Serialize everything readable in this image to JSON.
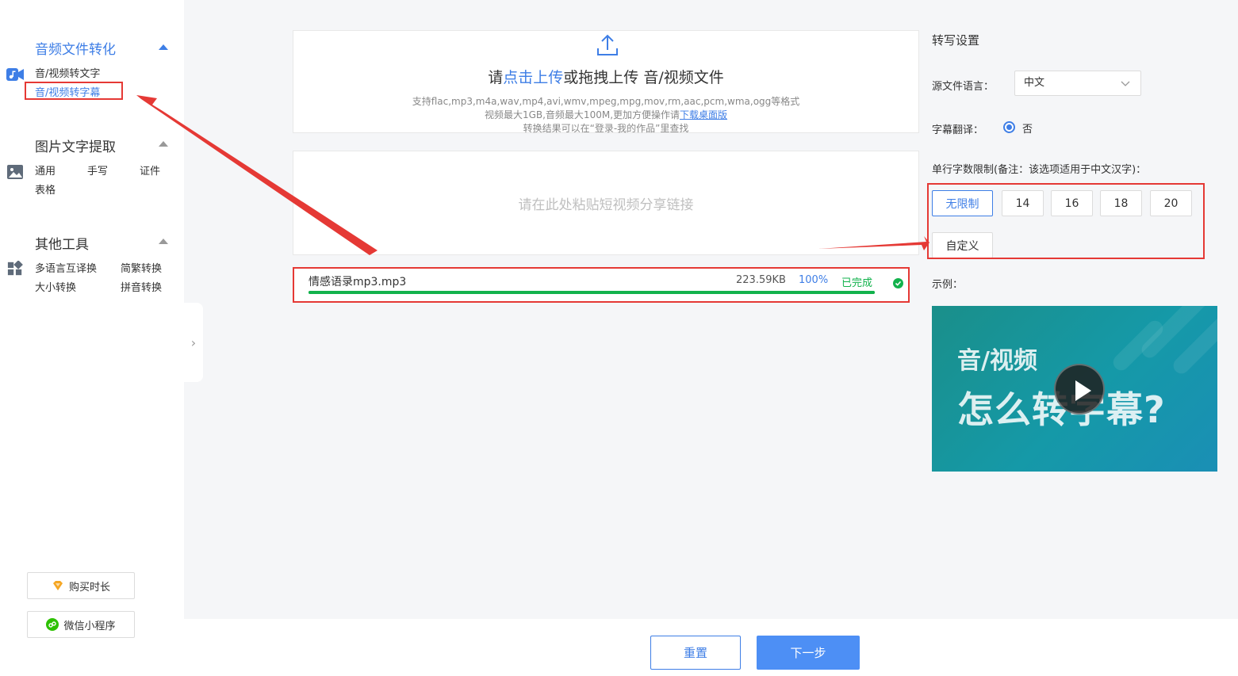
{
  "sidebar": {
    "sections": [
      {
        "title": "音频文件转化",
        "items": [
          "音/视频转文字",
          "音/视频转字幕"
        ]
      },
      {
        "title": "图片文字提取",
        "items": [
          "通用",
          "手写",
          "证件",
          "表格"
        ]
      },
      {
        "title": "其他工具",
        "items": [
          "多语言互译换",
          "简繁转换",
          "大小转换",
          "拼音转换"
        ]
      }
    ],
    "buy_label": "购买时长",
    "wechat_label": "微信小程序"
  },
  "upload": {
    "title_prefix": "请",
    "title_link": "点击上传",
    "title_suffix": "或拖拽上传 音/视频文件",
    "formats": "支持flac,mp3,m4a,wav,mp4,avi,wmv,mpeg,mpg,mov,rm,aac,pcm,wma,ogg等格式",
    "limit_text": "视频最大1GB,音频最大100M,更加方便操作请",
    "download_link": "下载桌面版",
    "result_text": "转换结果可以在“登录-我的作品”里查找"
  },
  "paste": {
    "placeholder": "请在此处粘贴短视频分享链接"
  },
  "file": {
    "name": "情感语录mp3.mp3",
    "size": "223.59KB",
    "percent": "100%",
    "progress": 1.0,
    "status": "已完成"
  },
  "settings": {
    "title": "转写设置",
    "source_lang_label": "源文件语言：",
    "source_lang_value": "中文",
    "translate_label": "字幕翻译：",
    "translate_value": "否",
    "limit_label": "单行字数限制(备注：该选项适用于中文汉字)：",
    "limit_options": [
      "无限制",
      "14",
      "16",
      "18",
      "20"
    ],
    "custom_label": "自定义",
    "example_label": "示例：",
    "video_line1": "音/视频",
    "video_line2": "怎么转字幕?"
  },
  "actions": {
    "reset_label": "重置",
    "next_label": "下一步"
  },
  "colors": {
    "accent": "#3e7ee6",
    "success": "#12b24c",
    "highlight": "#e53935"
  }
}
